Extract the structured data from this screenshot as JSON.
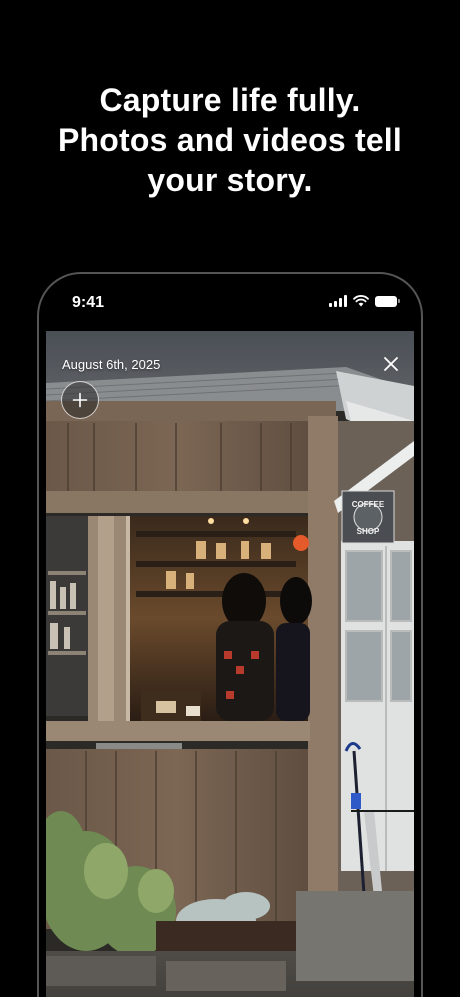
{
  "headline": {
    "line1": "Capture life fully.",
    "line2": "Photos and videos tell",
    "line3": "your story."
  },
  "status_bar": {
    "time": "9:41",
    "icons": [
      "signal-icon",
      "wifi-icon",
      "battery-icon"
    ]
  },
  "photo_view": {
    "date": "August 6th, 2025",
    "close_icon": "close-icon",
    "add_icon": "plus-icon",
    "sign_text": "COFFEE SHOP"
  }
}
